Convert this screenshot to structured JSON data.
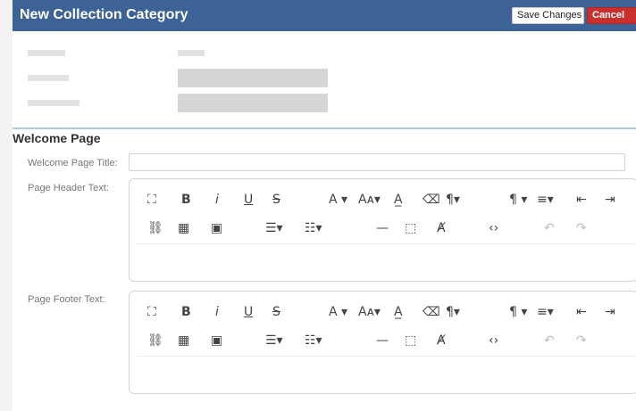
{
  "header": {
    "title": "New Collection Category",
    "save_label": "Save Changes",
    "cancel_label": "Cancel",
    "background": "#3c6296"
  },
  "section": {
    "title": "Welcome Page"
  },
  "fields": {
    "welcome_title_label": "Welcome Page Title:",
    "welcome_title_value": "",
    "header_text_label": "Page Header Text:",
    "footer_text_label": "Page Footer Text:"
  },
  "toolbar_icons": {
    "row1": [
      "fullscreen-icon",
      "bold-icon",
      "italic-icon",
      "underline-icon",
      "strikethrough-icon",
      "font-color-icon",
      "font-size-icon",
      "text-highlight-icon",
      "clear-format-icon",
      "paragraph-format-icon",
      "paragraph-icon",
      "align-icon",
      "outdent-icon",
      "indent-icon"
    ],
    "row2": [
      "link-icon",
      "table-icon",
      "image-icon",
      "ordered-list-icon",
      "unordered-list-icon",
      "horizontal-line-icon",
      "select-all-icon",
      "clear-icon",
      "code-view-icon",
      "undo-icon",
      "redo-icon"
    ]
  }
}
